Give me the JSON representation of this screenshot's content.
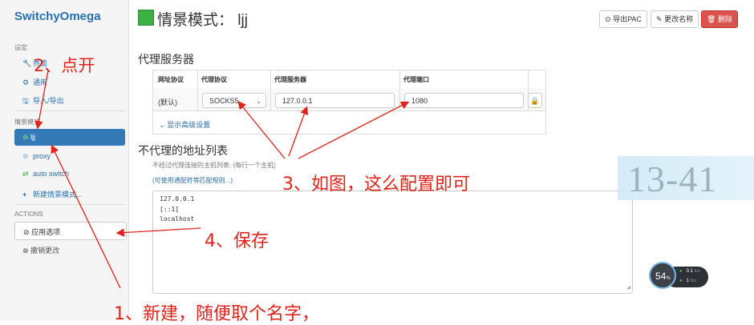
{
  "sidebar": {
    "brand": "SwitchyOmega",
    "settings_label": "设定",
    "settings_items": [
      {
        "icon": "wrench-icon",
        "label": "界面"
      },
      {
        "icon": "gear-icon",
        "label": "通用"
      },
      {
        "icon": "floppy-icon",
        "label": "导入/导出"
      }
    ],
    "profiles_label": "情景模式",
    "profiles": [
      {
        "icon": "globe-icon",
        "label": "ljj",
        "active": true
      },
      {
        "icon": "globe-icon",
        "label": "proxy"
      },
      {
        "icon": "retweet-icon",
        "label": "auto switch"
      }
    ],
    "new_profile": "新建情景模式...",
    "actions_label": "ACTIONS",
    "apply_label": "应用选项",
    "discard_label": "撤销更改"
  },
  "header": {
    "title": "情景模式：  ljj",
    "profile_color": "#3cb043",
    "export_pac": "导出PAC",
    "rename": "更改名称",
    "delete": "删除"
  },
  "proxy_servers": {
    "title": "代理服务器",
    "columns": [
      "网址协议",
      "代理协议",
      "代理服务器",
      "代理端口"
    ],
    "row": {
      "scheme": "(默认)",
      "protocol": "SOCKS5",
      "server": "127.0.0.1",
      "port": "1080"
    },
    "advanced_link": "显示高级设置"
  },
  "bypass": {
    "title": "不代理的地址列表",
    "help": "不经过代理连接的主机列表: (每行一个主机)",
    "wildcard_link": "(可使用通配符等匹配规则...)",
    "entries": [
      "127.0.0.1",
      "[::1]",
      "localhost"
    ]
  },
  "watermark": "13-41",
  "speed_widget": {
    "percent": "54",
    "percent_unit": "%",
    "up": "0.1",
    "down": "1",
    "unit": "K/s"
  },
  "annotations": {
    "a1": "1、新建，随便取个名字，",
    "a2": "2、点开",
    "a3": "3、如图，这么配置即可",
    "a4": "4、保存"
  },
  "colors": {
    "accent": "#337ab7",
    "danger": "#d9534f",
    "annotation": "#e0231c"
  }
}
